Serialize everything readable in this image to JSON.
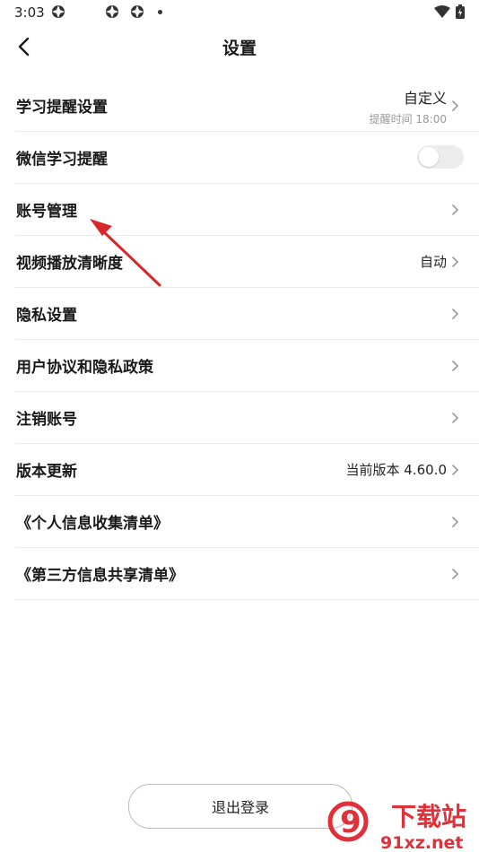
{
  "status_bar": {
    "time": "3:03"
  },
  "header": {
    "title": "设置"
  },
  "settings": [
    {
      "label": "学习提醒设置",
      "value": "自定义",
      "sub": "提醒时间 18:00"
    },
    {
      "label": "微信学习提醒",
      "toggle": false
    },
    {
      "label": "账号管理"
    },
    {
      "label": "视频播放清晰度",
      "value": "自动"
    },
    {
      "label": "隐私设置"
    },
    {
      "label": "用户协议和隐私政策"
    },
    {
      "label": "注销账号"
    },
    {
      "label": "版本更新",
      "value": "当前版本 4.60.0"
    },
    {
      "label": "《个人信息收集清单》"
    },
    {
      "label": "《第三方信息共享清单》"
    }
  ],
  "logout_label": "退出登录",
  "watermark": {
    "brand": "下载站",
    "domain": "91xz.net",
    "logo_text": "9"
  },
  "colors": {
    "annotation_arrow": "#d9262b",
    "toggle_off": "#ececec",
    "divider": "#ececec",
    "watermark": "#e0303a"
  }
}
